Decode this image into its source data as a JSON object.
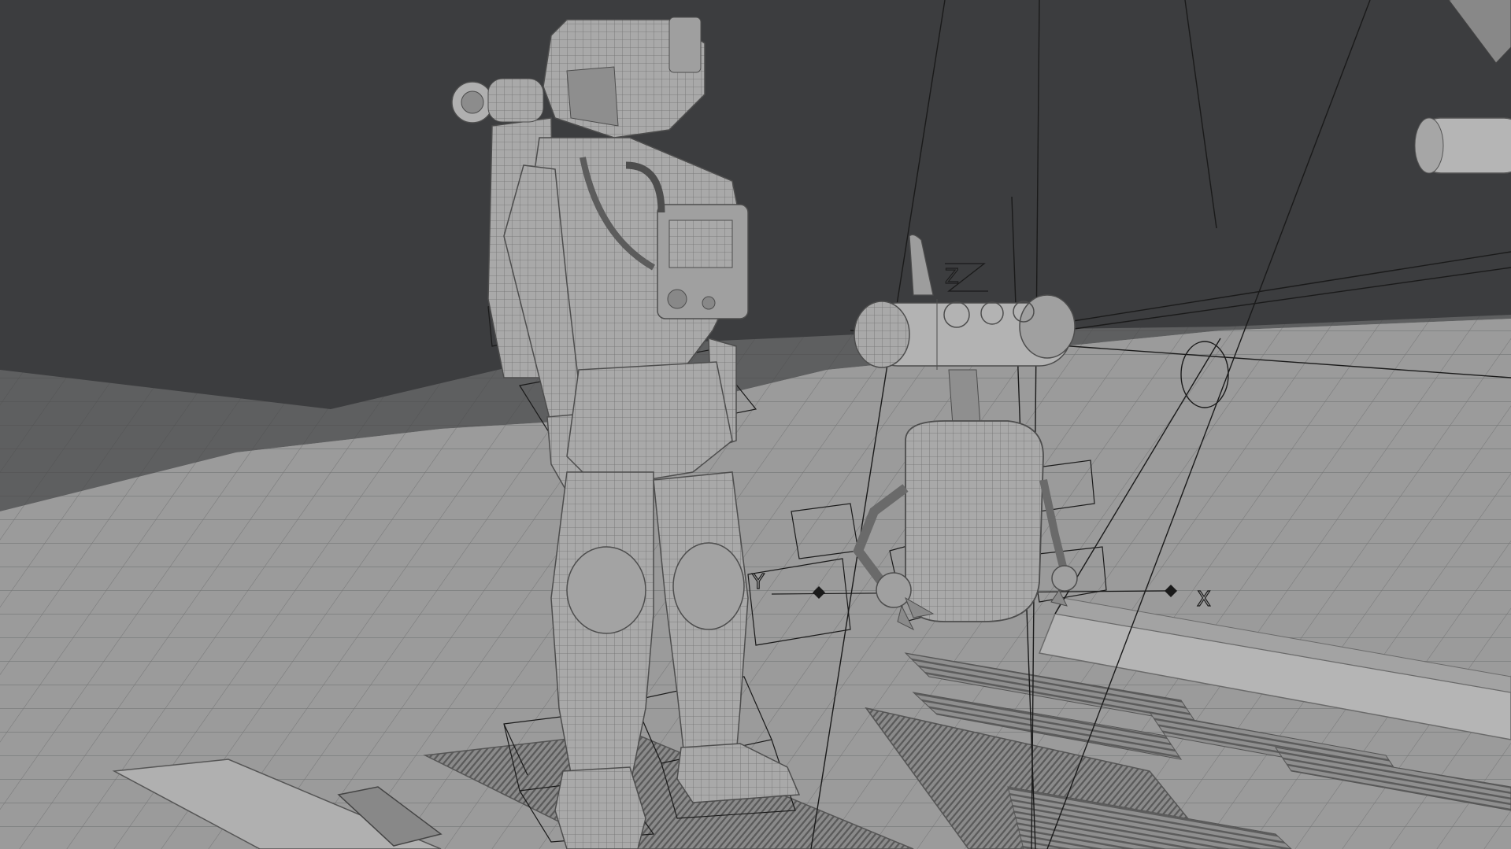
{
  "viewport": {
    "kind": "3D viewport",
    "shading": "wireframe-over-solid",
    "colors": {
      "background": "#3c3d3f",
      "ground": "#9c9c9c",
      "ground_far": "#8d8e8f",
      "wire": "#5f6061",
      "model": "#a8a8a8",
      "model_dark": "#7d7d7d",
      "rig_line": "#1a1a1a"
    }
  },
  "objects": {
    "astronaut": {
      "name_icon": "astronaut-model",
      "selected": false
    },
    "robot": {
      "name_icon": "robot-model",
      "selected": false
    },
    "floor_grates": {
      "name_icon": "floor-grate"
    },
    "space_station_arm": {
      "name_icon": "station-arm"
    }
  },
  "axis_labels": {
    "robot_y": "Y",
    "robot_x": "X",
    "robot_z": "Z"
  }
}
